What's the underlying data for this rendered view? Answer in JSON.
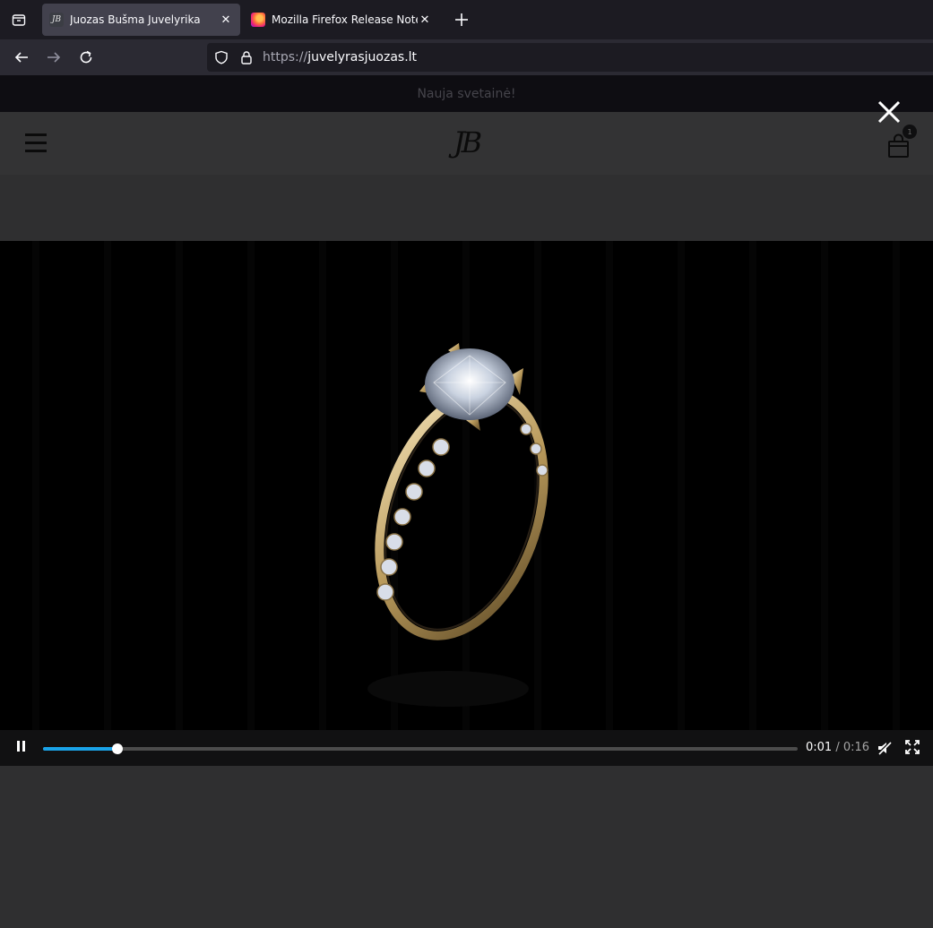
{
  "browser": {
    "tabs": [
      {
        "title": "Juozas Bušma Juvelyrika",
        "favicon": "jb-logo-icon",
        "active": true
      },
      {
        "title": "Mozilla Firefox Release Notes",
        "favicon": "firefox-icon",
        "active": false
      }
    ],
    "url_scheme": "https://",
    "url_host": "juvelyrasjuozas.lt"
  },
  "page": {
    "announcement": "Nauja svetainė!",
    "logo_text": "JB",
    "cart_count": "1"
  },
  "video": {
    "current_time": "0:01",
    "separator": " / ",
    "duration": "0:16",
    "progress_fraction": 0.0986,
    "state": "playing",
    "accent_color": "#1aa3e8"
  },
  "colors": {
    "chrome_dark": "#1c1b22",
    "tab_active": "#42414d",
    "page_bg": "#2f2f30"
  }
}
